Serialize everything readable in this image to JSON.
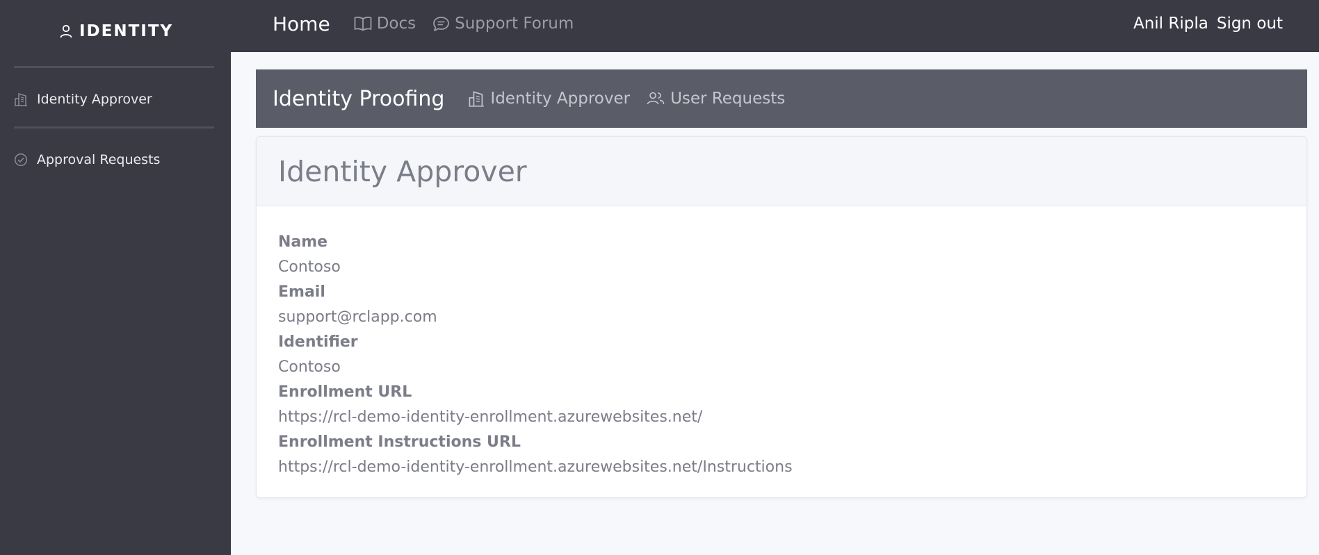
{
  "topbar": {
    "brand": "IDENTITY",
    "home_label": "Home",
    "docs_label": "Docs",
    "forum_label": "Support Forum",
    "user_name": "Anil Ripla",
    "signout_label": "Sign out"
  },
  "sidebar": {
    "items": [
      {
        "label": "Identity Approver",
        "icon": "building-icon"
      },
      {
        "label": "Approval Requests",
        "icon": "check-circle-icon"
      }
    ]
  },
  "subheader": {
    "title": "Identity Proofing",
    "links": [
      {
        "label": "Identity Approver",
        "icon": "building-icon"
      },
      {
        "label": "User Requests",
        "icon": "users-icon"
      }
    ]
  },
  "card": {
    "title": "Identity Approver",
    "fields": [
      {
        "label": "Name",
        "value": "Contoso"
      },
      {
        "label": "Email",
        "value": "support@rclapp.com"
      },
      {
        "label": "Identifier",
        "value": "Contoso"
      },
      {
        "label": "Enrollment URL",
        "value": "https://rcl-demo-identity-enrollment.azurewebsites.net/"
      },
      {
        "label": "Enrollment Instructions URL",
        "value": "https://rcl-demo-identity-enrollment.azurewebsites.net/Instructions"
      }
    ]
  },
  "colors": {
    "sidebar_bg": "#3a3a45",
    "subheader_bg": "#5a5c68",
    "content_bg": "#f7f8fb",
    "text_muted": "#7b7d88"
  }
}
